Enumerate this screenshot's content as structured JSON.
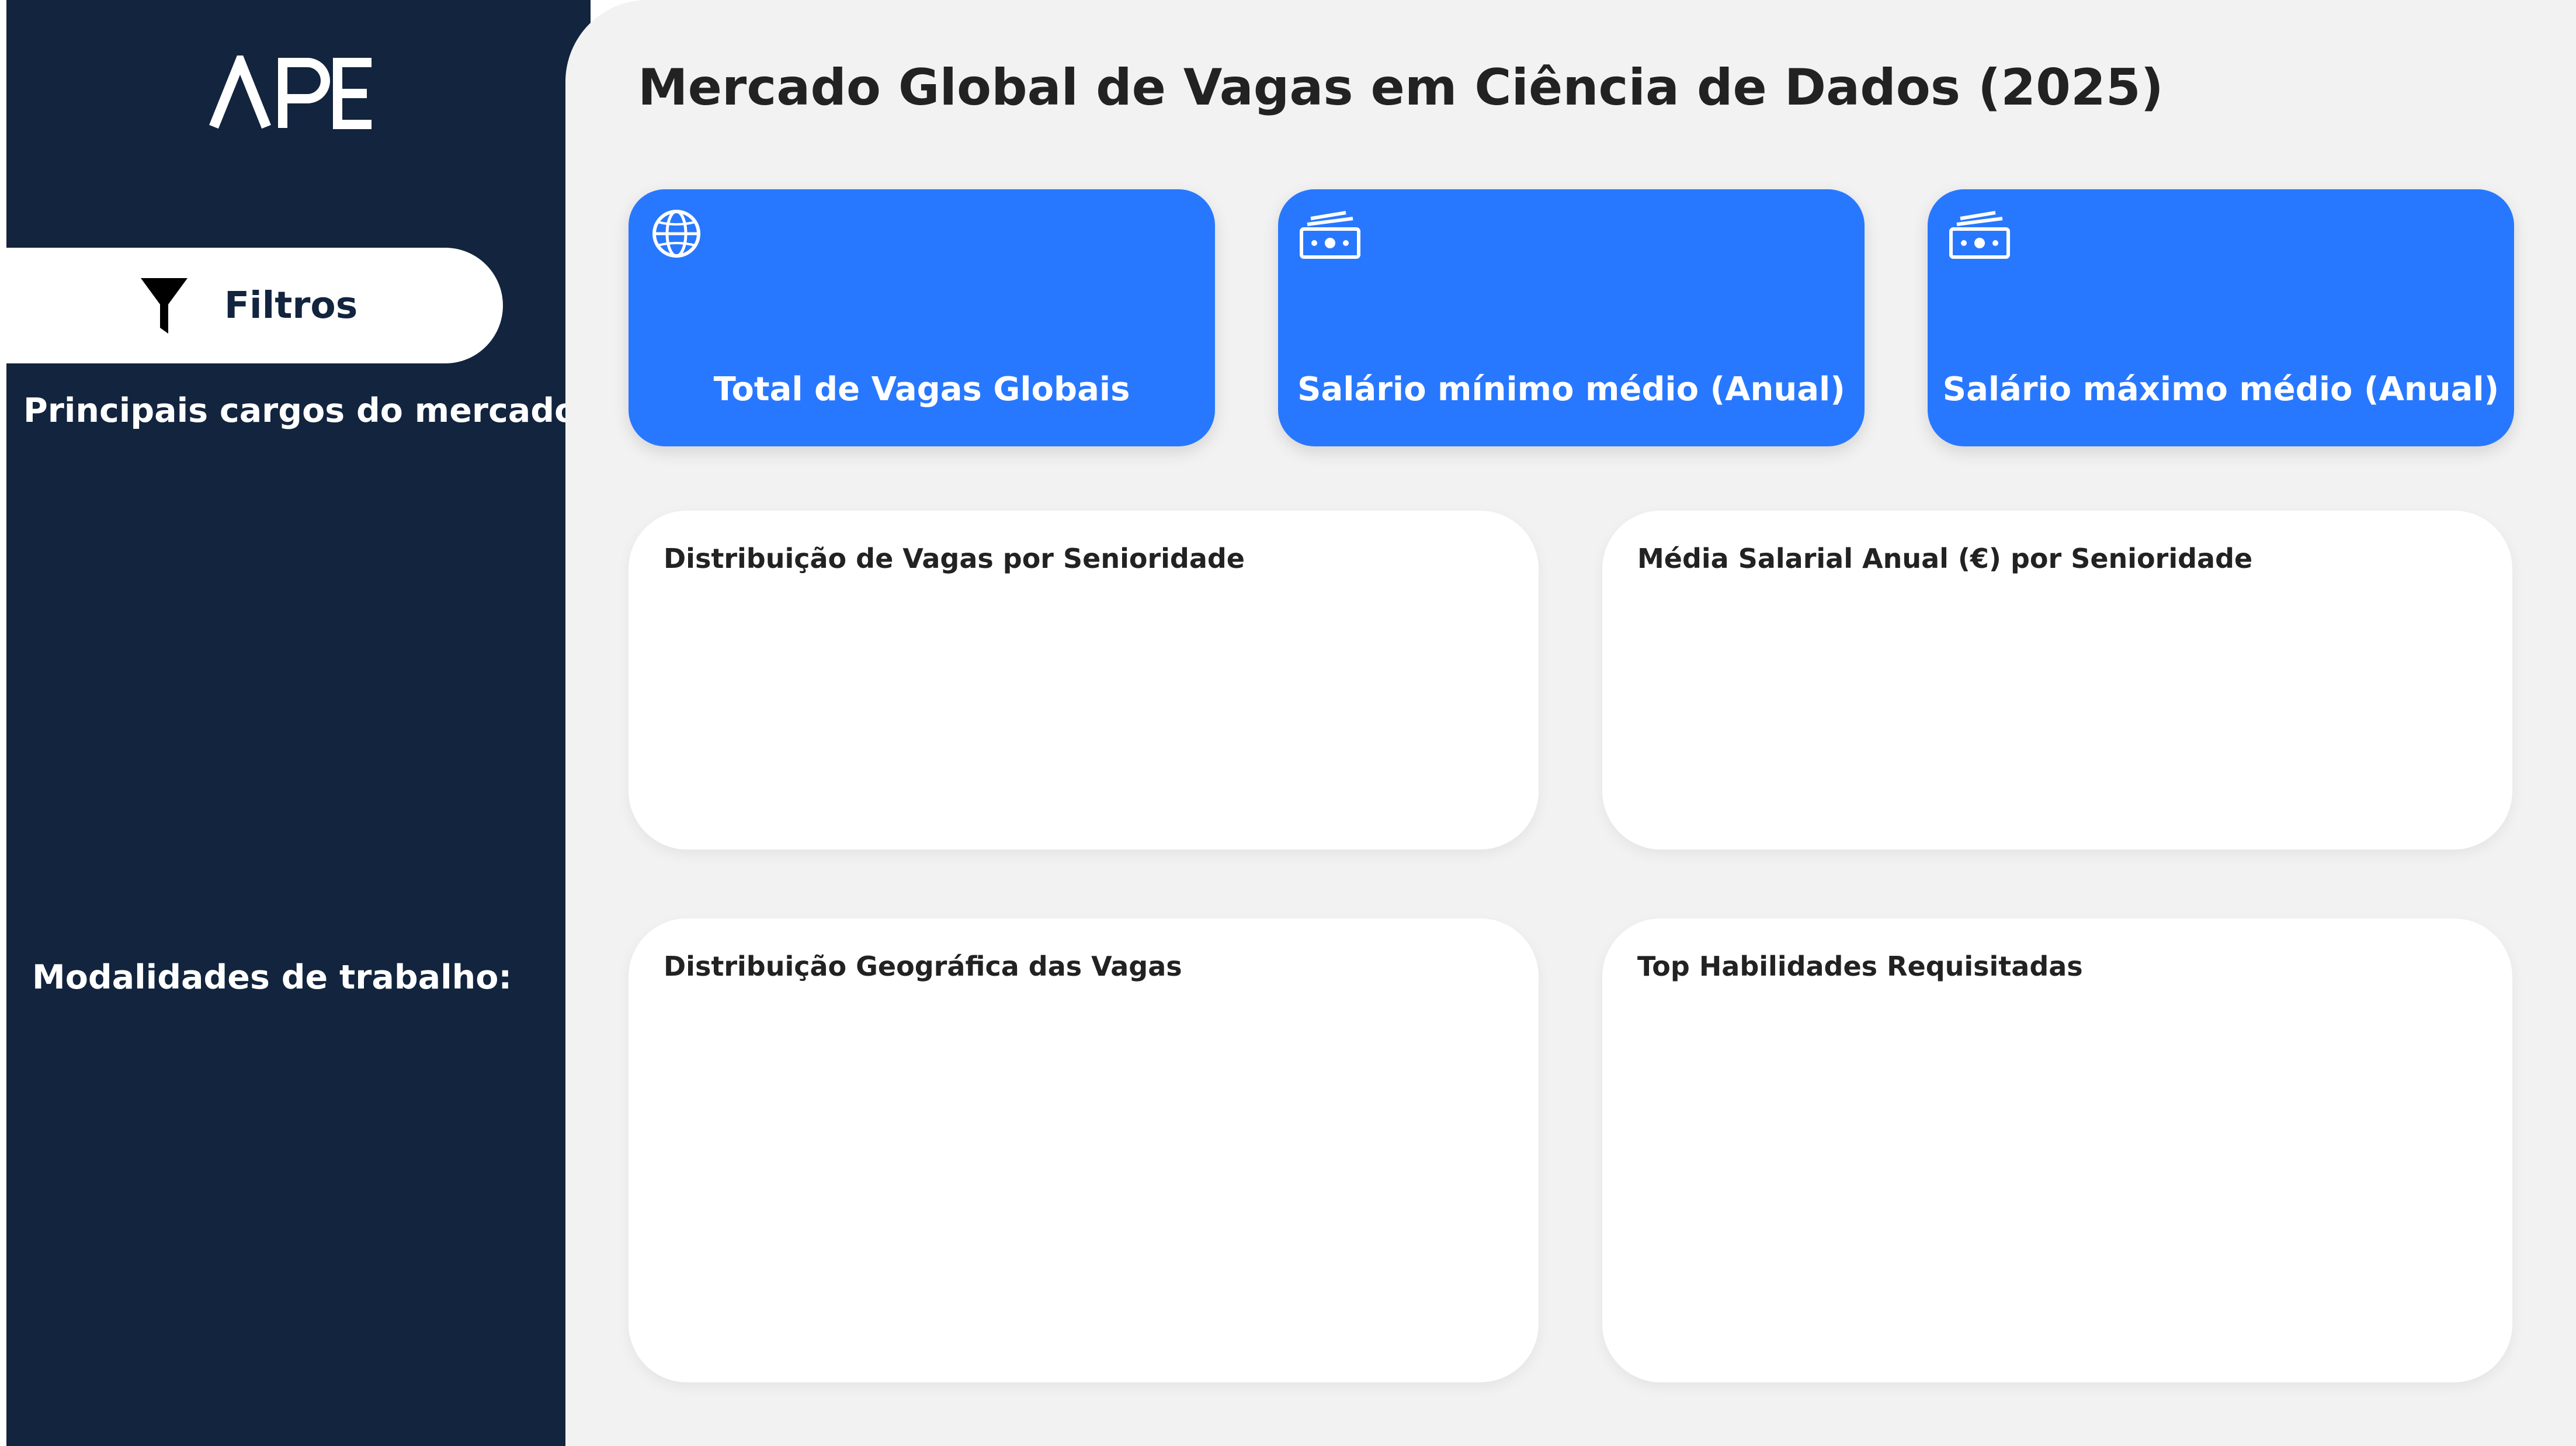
{
  "sidebar": {
    "logo_text": "APE",
    "filters_label": "Filtros",
    "filters_icon": "funnel-icon",
    "section_roles": "Principais cargos do mercado:",
    "section_modes": "Modalidades de trabalho:",
    "colors": {
      "background": "#12243e",
      "filter_button": "#ffffff"
    }
  },
  "header": {
    "title": "Mercado Global de Vagas em Ciência de Dados (2025)"
  },
  "kpis": [
    {
      "label": "Total de Vagas Globais",
      "icon": "globe-icon"
    },
    {
      "label": "Salário mínimo médio (Anual)",
      "icon": "money-icon"
    },
    {
      "label": "Salário máximo médio (Anual)",
      "icon": "money-icon"
    }
  ],
  "panels": [
    {
      "title": "Distribuição de Vagas por Senioridade"
    },
    {
      "title": "Média Salarial Anual (€) por Senioridade"
    },
    {
      "title": "Distribuição Geográfica das Vagas"
    },
    {
      "title": "Top Habilidades Requisitadas"
    }
  ],
  "colors": {
    "accent": "#2878ff",
    "canvas": "#f2f2f2",
    "panel": "#ffffff"
  }
}
